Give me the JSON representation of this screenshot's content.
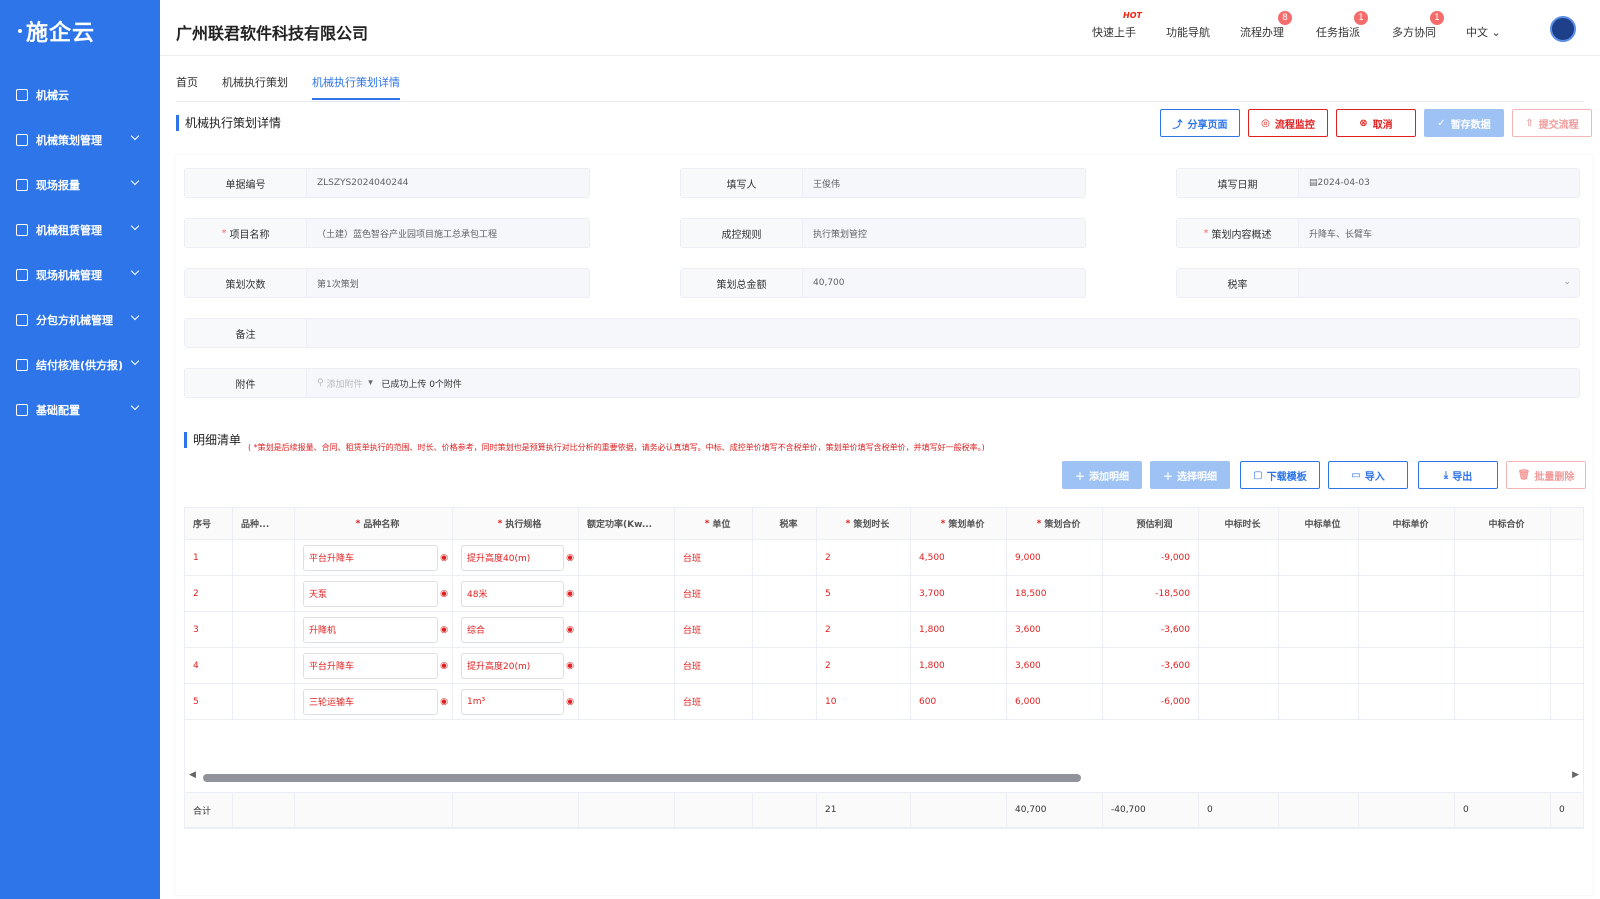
{
  "brand": "施企云",
  "sidebar": {
    "items": [
      {
        "label": "机械云",
        "icon": "grid-icon"
      },
      {
        "label": "机械策划管理",
        "icon": "database-icon"
      },
      {
        "label": "现场报量",
        "icon": "report-icon"
      },
      {
        "label": "机械租赁管理",
        "icon": "org-icon"
      },
      {
        "label": "现场机械管理",
        "icon": "machine-icon"
      },
      {
        "label": "分包方机械管理",
        "icon": "contract-icon"
      },
      {
        "label": "结付核准(供方报)",
        "icon": "doc-icon"
      },
      {
        "label": "基础配置",
        "icon": "apps-icon"
      }
    ]
  },
  "header": {
    "company": "广州联君软件科技有限公司",
    "nav": [
      {
        "label": "快速上手",
        "badge": "HOT"
      },
      {
        "label": "功能导航",
        "badge": ""
      },
      {
        "label": "流程办理",
        "badge": "8"
      },
      {
        "label": "任务指派",
        "badge": "1"
      },
      {
        "label": "多方协同",
        "badge": "1"
      }
    ],
    "lang": "中文"
  },
  "tabs": [
    "首页",
    "机械执行策划",
    "机械执行策划详情"
  ],
  "page_title": "机械执行策划详情",
  "actions": {
    "share": "分享页面",
    "monitor": "流程监控",
    "cancel": "取消",
    "save": "暂存数据",
    "submit": "提交流程"
  },
  "form": {
    "doc_no": {
      "label": "单据编号",
      "value": "ZLSZYS2024040244"
    },
    "author": {
      "label": "填写人",
      "value": "王俊伟"
    },
    "date": {
      "label": "填写日期",
      "value": "2024-04-03"
    },
    "project": {
      "label": "项目名称",
      "value": "（土建）蓝色智谷产业园项目施工总承包工程"
    },
    "rule": {
      "label": "成控规则",
      "value": "执行策划管控"
    },
    "summary": {
      "label": "策划内容概述",
      "value": "升降车、长臂车"
    },
    "times": {
      "label": "策划次数",
      "value": "第1次策划"
    },
    "total": {
      "label": "策划总金额",
      "value": "40,700"
    },
    "tax": {
      "label": "税率",
      "value": ""
    },
    "remark": {
      "label": "备注",
      "value": ""
    },
    "attach": {
      "label": "附件",
      "add": "添加附件",
      "status": "已成功上传 0个附件"
    }
  },
  "detail": {
    "title": "明细清单",
    "note": "( *策划是后续报量、合同、租赁单执行的范围、时长、价格参考，同时策划也是预算执行对比分析的重要依据，请务必认真填写。中标、成控单价填写不含税单价，策划单价填写含税单价，并填写好一般税率。)",
    "buttons": {
      "add": "添加明细",
      "select": "选择明细",
      "download": "下载模板",
      "import": "导入",
      "export": "导出",
      "delete": "批量删除"
    },
    "columns": [
      "序号",
      "品种...",
      "品种名称",
      "执行规格",
      "额定功率(Kw...",
      "单位",
      "税率",
      "策划时长",
      "策划单价",
      "策划合价",
      "预估利润",
      "中标时长",
      "中标单位",
      "中标单价",
      "中标合价"
    ],
    "rows": [
      {
        "no": "1",
        "name": "平台升降车",
        "spec": "提升高度40(m)",
        "unit": "台班",
        "dur": "2",
        "price": "4,500",
        "amount": "9,000",
        "profit": "-9,000"
      },
      {
        "no": "2",
        "name": "天泵",
        "spec": "48米",
        "unit": "台班",
        "dur": "5",
        "price": "3,700",
        "amount": "18,500",
        "profit": "-18,500"
      },
      {
        "no": "3",
        "name": "升降机",
        "spec": "综合",
        "unit": "台班",
        "dur": "2",
        "price": "1,800",
        "amount": "3,600",
        "profit": "-3,600"
      },
      {
        "no": "4",
        "name": "平台升降车",
        "spec": "提升高度20(m)",
        "unit": "台班",
        "dur": "2",
        "price": "1,800",
        "amount": "3,600",
        "profit": "-3,600"
      },
      {
        "no": "5",
        "name": "三轮运输车",
        "spec": "1m³",
        "unit": "台班",
        "dur": "10",
        "price": "600",
        "amount": "6,000",
        "profit": "-6,000"
      }
    ],
    "footer": {
      "label": "合计",
      "dur": "21",
      "amount": "40,700",
      "profit": "-40,700",
      "win_dur": "0",
      "win_total": "0",
      "last": "0"
    }
  }
}
